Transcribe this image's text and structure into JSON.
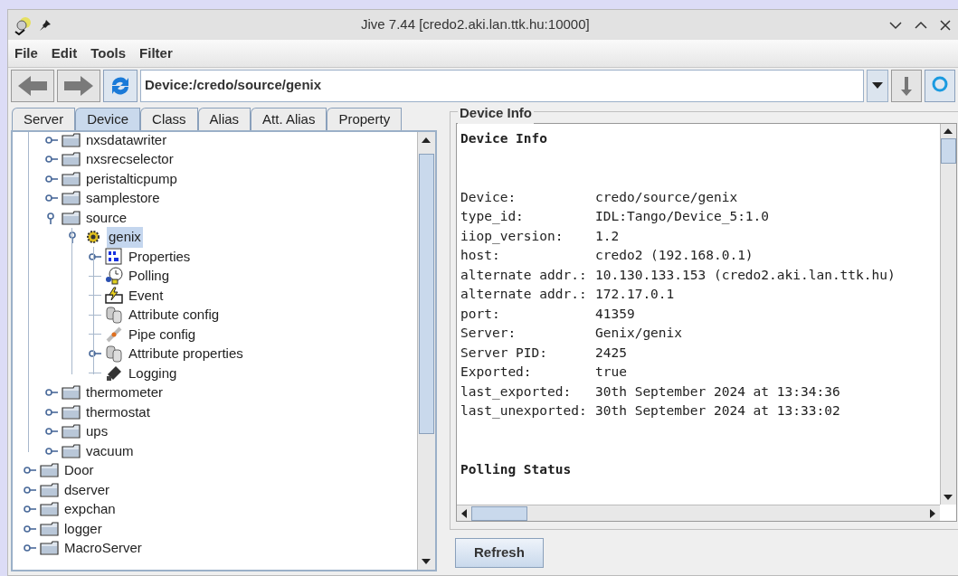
{
  "window": {
    "title": "Jive 7.44 [credo2.aki.lan.ttk.hu:10000]"
  },
  "menu": [
    "File",
    "Edit",
    "Tools",
    "Filter"
  ],
  "address": {
    "value": "Device:/credo/source/genix"
  },
  "tabs": [
    {
      "label": "Server",
      "selected": false
    },
    {
      "label": "Device",
      "selected": true
    },
    {
      "label": "Class",
      "selected": false
    },
    {
      "label": "Alias",
      "selected": false
    },
    {
      "label": "Att. Alias",
      "selected": false
    },
    {
      "label": "Property",
      "selected": false
    }
  ],
  "tree": [
    {
      "children": [
        {
          "label": "nxsdatawriter",
          "kind": "folder",
          "expanded": false,
          "selected": false
        },
        {
          "label": "nxsrecselector",
          "kind": "folder",
          "expanded": false,
          "selected": false
        },
        {
          "label": "peristalticpump",
          "kind": "folder",
          "expanded": false,
          "selected": false
        },
        {
          "label": "samplestore",
          "kind": "folder",
          "expanded": false,
          "selected": false
        },
        {
          "label": "source",
          "kind": "folder",
          "expanded": true,
          "selected": false,
          "children": [
            {
              "label": "genix",
              "kind": "device",
              "expanded": true,
              "selected": true,
              "children": [
                {
                  "label": "Properties",
                  "kind": "properties",
                  "expanded": false,
                  "selected": false
                },
                {
                  "label": "Polling",
                  "kind": "polling",
                  "selected": false
                },
                {
                  "label": "Event",
                  "kind": "event",
                  "selected": false
                },
                {
                  "label": "Attribute config",
                  "kind": "attribute",
                  "selected": false
                },
                {
                  "label": "Pipe config",
                  "kind": "pipe",
                  "selected": false
                },
                {
                  "label": "Attribute properties",
                  "kind": "attribute",
                  "expanded": false,
                  "selected": false
                },
                {
                  "label": "Logging",
                  "kind": "logging",
                  "selected": false
                }
              ]
            }
          ]
        },
        {
          "label": "thermometer",
          "kind": "folder",
          "expanded": false,
          "selected": false
        },
        {
          "label": "thermostat",
          "kind": "folder",
          "expanded": false,
          "selected": false
        },
        {
          "label": "ups",
          "kind": "folder",
          "expanded": false,
          "selected": false
        },
        {
          "label": "vacuum",
          "kind": "folder",
          "expanded": false,
          "selected": false
        }
      ]
    },
    {
      "label": "Door",
      "kind": "folder",
      "expanded": false,
      "selected": false
    },
    {
      "label": "dserver",
      "kind": "folder",
      "expanded": false,
      "selected": false
    },
    {
      "label": "expchan",
      "kind": "folder",
      "expanded": false,
      "selected": false
    },
    {
      "label": "logger",
      "kind": "folder",
      "expanded": false,
      "selected": false
    },
    {
      "label": "MacroServer",
      "kind": "folder",
      "expanded": false,
      "selected": false
    }
  ],
  "info": {
    "title": "Device Info",
    "heading": "Device Info",
    "rows": [
      {
        "label": "Device:",
        "value": "credo/source/genix"
      },
      {
        "label": "type_id:",
        "value": "IDL:Tango/Device_5:1.0"
      },
      {
        "label": "iiop_version:",
        "value": "1.2"
      },
      {
        "label": "host:",
        "value": "credo2 (192.168.0.1)"
      },
      {
        "label": "alternate addr.:",
        "value": "10.130.133.153 (credo2.aki.lan.ttk.hu)"
      },
      {
        "label": "alternate addr.:",
        "value": "172.17.0.1"
      },
      {
        "label": "port:",
        "value": "41359"
      },
      {
        "label": "Server:",
        "value": "Genix/genix"
      },
      {
        "label": "Server PID:",
        "value": "2425"
      },
      {
        "label": "Exported:",
        "value": "true"
      },
      {
        "label": "last_exported:",
        "value": "30th September 2024 at 13:34:36"
      },
      {
        "label": "last_unexported:",
        "value": "30th September 2024 at 13:33:02"
      }
    ],
    "section": "Polling Status"
  },
  "refresh_button": "Refresh"
}
